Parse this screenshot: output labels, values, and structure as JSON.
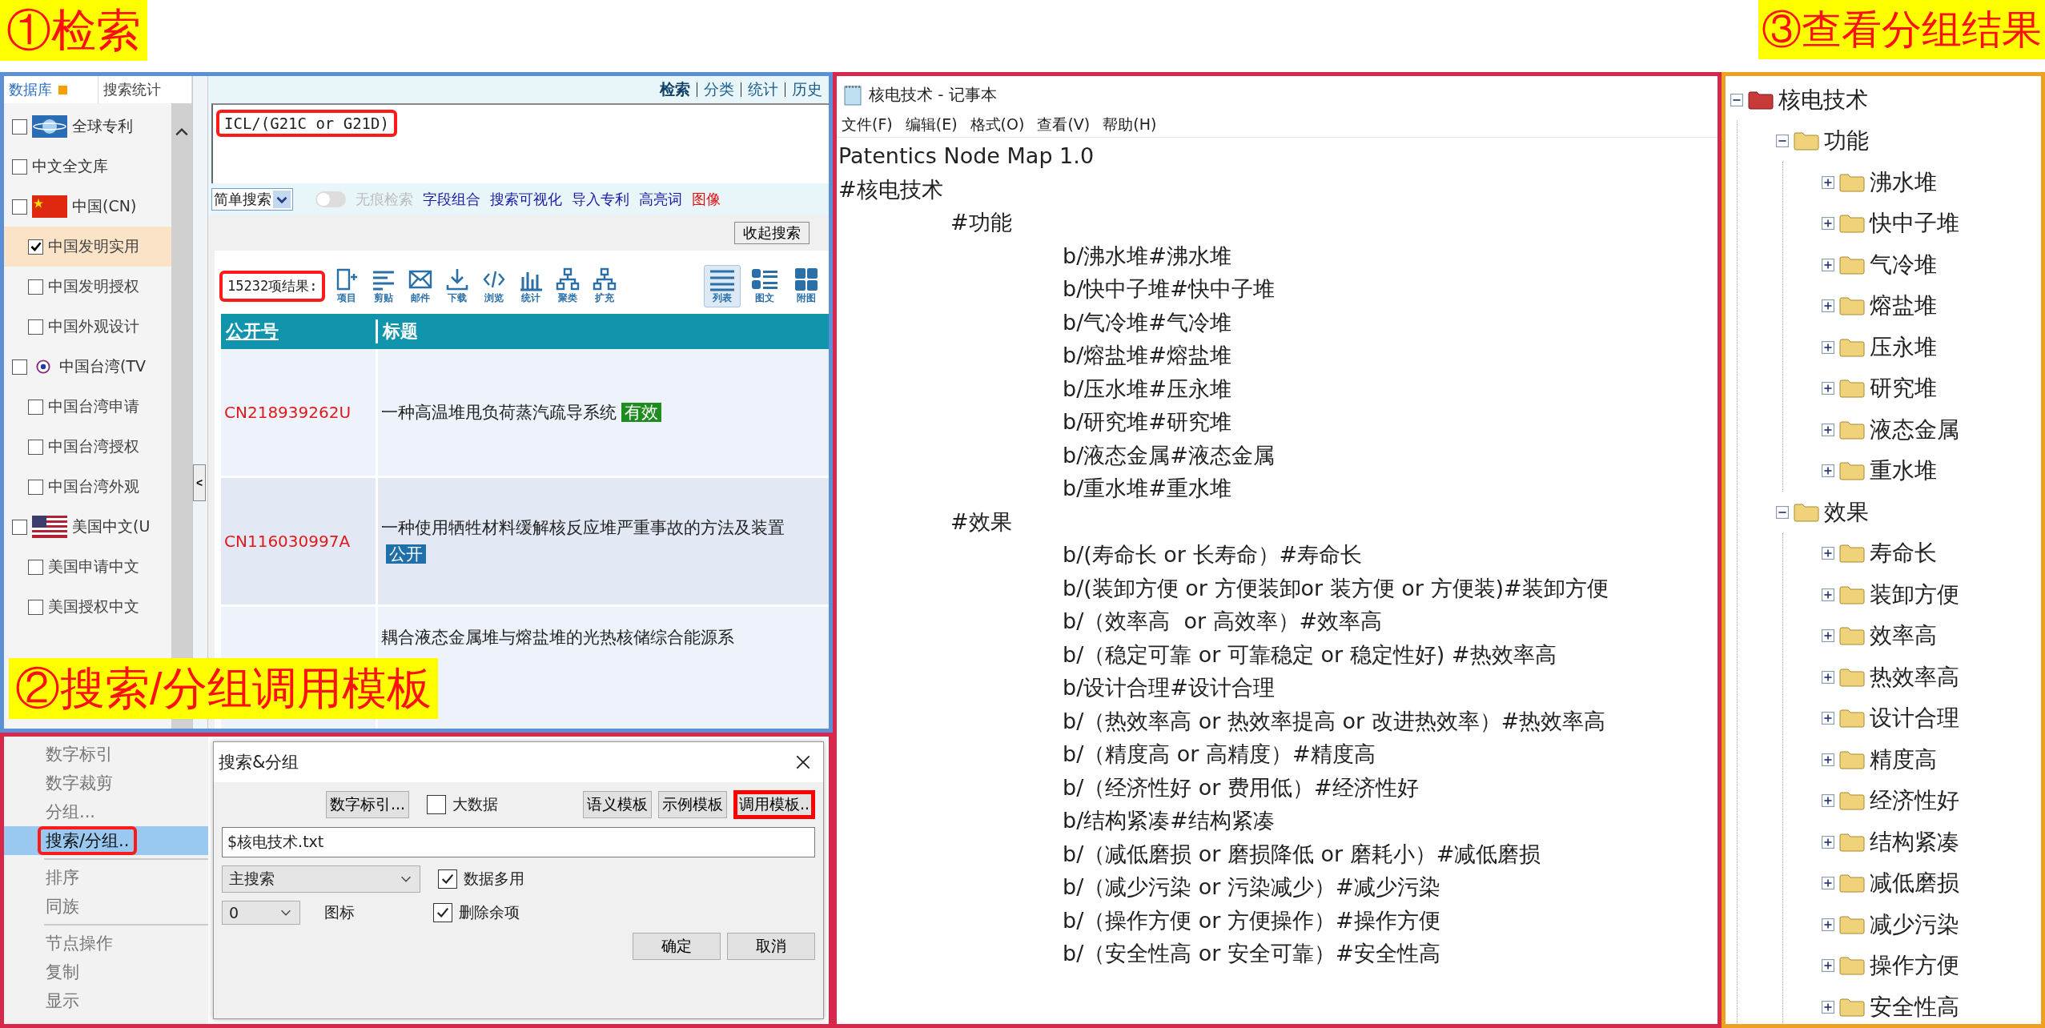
{
  "search_panel": {
    "step_label": "①检索",
    "sidebar": {
      "tabs": [
        {
          "label": "数据库",
          "selected": true
        },
        {
          "label": "搜索统计",
          "selected": false
        }
      ],
      "items": [
        {
          "label": "全球专利",
          "checked": false,
          "selected": false
        },
        {
          "label": "中文全文库",
          "checked": false,
          "selected": false
        },
        {
          "label": "中国(CN)",
          "checked": false,
          "selected": false,
          "children": [
            {
              "label": "中国发明实用",
              "checked": true,
              "selected": true
            },
            {
              "label": "中国发明授权",
              "checked": false,
              "selected": false
            },
            {
              "label": "中国外观设计",
              "checked": false,
              "selected": false
            }
          ]
        },
        {
          "label": "中国台湾(TV",
          "checked": false,
          "selected": false,
          "children": [
            {
              "label": "中国台湾申请",
              "checked": false,
              "selected": false
            },
            {
              "label": "中国台湾授权",
              "checked": false,
              "selected": false
            },
            {
              "label": "中国台湾外观",
              "checked": false,
              "selected": false
            }
          ]
        },
        {
          "label": "美国中文(U",
          "checked": false,
          "selected": false,
          "children": [
            {
              "label": "美国申请中文",
              "checked": false,
              "selected": false
            },
            {
              "label": "美国授权中文",
              "checked": false,
              "selected": false
            }
          ]
        }
      ]
    },
    "collapse_button": "<",
    "top_links": [
      {
        "label": "检索",
        "selected": true
      },
      {
        "label": "分类",
        "selected": false
      },
      {
        "label": "统计",
        "selected": false
      },
      {
        "label": "历史",
        "selected": false
      }
    ],
    "query": {
      "value": "ICL/(G21C or G21D)",
      "annotated": true
    },
    "mode_select": "简单搜索",
    "incognito": {
      "label": "无痕检索",
      "on": false
    },
    "links": [
      {
        "label": "字段组合",
        "color": "#1a1aa6"
      },
      {
        "label": "搜索可视化",
        "color": "#1a1aa6"
      },
      {
        "label": "导入专利",
        "color": "#1a1aa6"
      },
      {
        "label": "高亮词",
        "color": "#1a1aa6"
      },
      {
        "label": "图像",
        "color": "#e01010"
      }
    ],
    "collapse_search_button": "收起搜索",
    "result_count": {
      "text": "15232项结果:",
      "annotated": true
    },
    "tools": [
      "项目",
      "剪贴",
      "邮件",
      "下载",
      "浏览",
      "统计",
      "聚类",
      "扩充"
    ],
    "views": [
      {
        "label": "列表",
        "selected": true
      },
      {
        "label": "图文",
        "selected": false
      },
      {
        "label": "附图",
        "selected": false
      }
    ],
    "table": {
      "columns": [
        "公开号",
        "标题"
      ],
      "rows": [
        {
          "number": "CN218939262U",
          "title": "一种高温堆甩负荷蒸汽疏导系统",
          "status": "有效",
          "kind": "valid"
        },
        {
          "number": "CN116030997A",
          "title": "一种使用牺牲材料缓解核反应堆严重事故的方法及装置",
          "status": "公开",
          "kind": "published"
        },
        {
          "title": "耦合液态金属堆与熔盐堆的光热核储综合能源系"
        }
      ]
    }
  },
  "group_panel": {
    "step_label": "②搜索/分组调用模板",
    "menu": [
      {
        "label": "数字标引",
        "selected": false,
        "annotated": false
      },
      {
        "label": "数字裁剪",
        "selected": false,
        "annotated": false
      },
      {
        "label": "分组...",
        "selected": false,
        "annotated": false
      },
      {
        "label": "搜索/分组..",
        "selected": true,
        "annotated": true
      },
      {
        "label": "排序",
        "selected": false,
        "annotated": false,
        "separator_before": true
      },
      {
        "label": "同族",
        "selected": false,
        "annotated": false
      },
      {
        "label": "节点操作",
        "selected": false,
        "annotated": false,
        "separator_before": true
      },
      {
        "label": "复制",
        "selected": false,
        "annotated": false
      },
      {
        "label": "显示",
        "selected": false,
        "annotated": false
      }
    ],
    "dialog": {
      "title": "搜索&分组",
      "index_button": "数字标引...",
      "big_data": {
        "label": "大数据",
        "checked": false
      },
      "template_buttons": [
        {
          "label": "语义模板",
          "annotated": false
        },
        {
          "label": "示例模板",
          "annotated": false
        },
        {
          "label": "调用模板..",
          "annotated": true
        }
      ],
      "file_input": "$核电技术.txt",
      "search_select": "主搜索",
      "multi_use": {
        "label": "数据多用",
        "checked": true
      },
      "icon_select": "0",
      "icon_label": "图标",
      "delete_rest": {
        "label": "删除余项",
        "checked": true
      },
      "buttons": [
        "确定",
        "取消"
      ]
    }
  },
  "notepad": {
    "title": "核电技术 - 记事本",
    "menu": [
      "文件(F)",
      "编辑(E)",
      "格式(O)",
      "查看(V)",
      "帮助(H)"
    ],
    "header": "Patentics Node Map 1.0",
    "outline": [
      {
        "text": "#核电技术",
        "children": [
          {
            "text": "#功能",
            "children": [
              {
                "text": "b/沸水堆#沸水堆"
              },
              {
                "text": "b/快中子堆#快中子堆"
              },
              {
                "text": "b/气冷堆#气冷堆"
              },
              {
                "text": "b/熔盐堆#熔盐堆"
              },
              {
                "text": "b/压水堆#压永堆"
              },
              {
                "text": "b/研究堆#研究堆"
              },
              {
                "text": "b/液态金属#液态金属"
              },
              {
                "text": "b/重水堆#重水堆"
              }
            ]
          },
          {
            "text": "#效果",
            "children": [
              {
                "text": "b/(寿命长 or 长寿命）#寿命长"
              },
              {
                "text": "b/(装卸方便 or 方便装卸or 装方便 or 方便装)#装卸方便"
              },
              {
                "text": "b/（效率高  or 高效率）#效率高"
              },
              {
                "text": "b/（稳定可靠 or 可靠稳定 or 稳定性好) #热效率高"
              },
              {
                "text": "b/设计合理#设计合理"
              },
              {
                "text": "b/（热效率高 or 热效率提高 or 改进热效率）#热效率高"
              },
              {
                "text": "b/（精度高 or 高精度）#精度高"
              },
              {
                "text": "b/（经济性好 or 费用低）#经济性好"
              },
              {
                "text": "b/结构紧凑#结构紧凑"
              },
              {
                "text": "b/（减低磨损 or 磨损降低 or 磨耗小）#减低磨损"
              },
              {
                "text": "b/（减少污染 or 污染减少）#减少污染"
              },
              {
                "text": "b/（操作方便 or 方便操作）#操作方便"
              },
              {
                "text": "b/（安全性高 or 安全可靠）#安全性高"
              }
            ]
          }
        ]
      }
    ]
  },
  "result_tree": {
    "step_label": "③查看分组结果",
    "nodes": [
      {
        "label": "核电技术",
        "expanded": true,
        "children": [
          {
            "label": "功能",
            "expanded": true,
            "children": [
              {
                "label": "沸水堆",
                "expanded": false
              },
              {
                "label": "快中子堆",
                "expanded": false
              },
              {
                "label": "气冷堆",
                "expanded": false
              },
              {
                "label": "熔盐堆",
                "expanded": false
              },
              {
                "label": "压永堆",
                "expanded": false
              },
              {
                "label": "研究堆",
                "expanded": false
              },
              {
                "label": "液态金属",
                "expanded": false
              },
              {
                "label": "重水堆",
                "expanded": false
              }
            ]
          },
          {
            "label": "效果",
            "expanded": true,
            "children": [
              {
                "label": "寿命长",
                "expanded": false
              },
              {
                "label": "装卸方便",
                "expanded": false
              },
              {
                "label": "效率高",
                "expanded": false
              },
              {
                "label": "热效率高",
                "expanded": false
              },
              {
                "label": "设计合理",
                "expanded": false
              },
              {
                "label": "精度高",
                "expanded": false
              },
              {
                "label": "经济性好",
                "expanded": false
              },
              {
                "label": "结构紧凑",
                "expanded": false
              },
              {
                "label": "减低磨损",
                "expanded": false
              },
              {
                "label": "减少污染",
                "expanded": false
              },
              {
                "label": "操作方便",
                "expanded": false
              },
              {
                "label": "安全性高",
                "expanded": false
              }
            ]
          }
        ]
      }
    ]
  }
}
